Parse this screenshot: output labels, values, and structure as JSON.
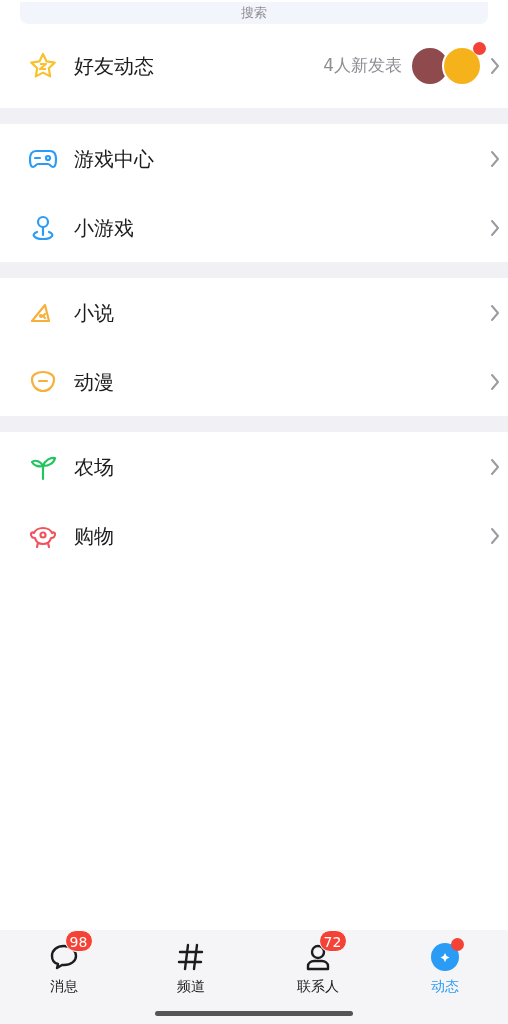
{
  "search": {
    "placeholder": "搜索"
  },
  "friend_feed": {
    "label": "好友动态",
    "summary": "4人新发表",
    "has_new": true
  },
  "groups": [
    {
      "items": [
        {
          "kind": "gamepad",
          "label": "游戏中心"
        },
        {
          "kind": "joystick",
          "label": "小游戏"
        }
      ]
    },
    {
      "items": [
        {
          "kind": "book",
          "label": "小说"
        },
        {
          "kind": "face",
          "label": "动漫"
        }
      ]
    },
    {
      "items": [
        {
          "kind": "sprout",
          "label": "农场"
        },
        {
          "kind": "pig",
          "label": "购物"
        }
      ]
    }
  ],
  "tabs": [
    {
      "kind": "chat",
      "label": "消息",
      "badge": "98",
      "dot": false,
      "selected": false
    },
    {
      "kind": "hash",
      "label": "频道",
      "dot": false,
      "selected": false
    },
    {
      "kind": "person",
      "label": "联系人",
      "badge": "72",
      "dot": false,
      "selected": false
    },
    {
      "kind": "star",
      "label": "动态",
      "dot": true,
      "selected": true
    }
  ]
}
